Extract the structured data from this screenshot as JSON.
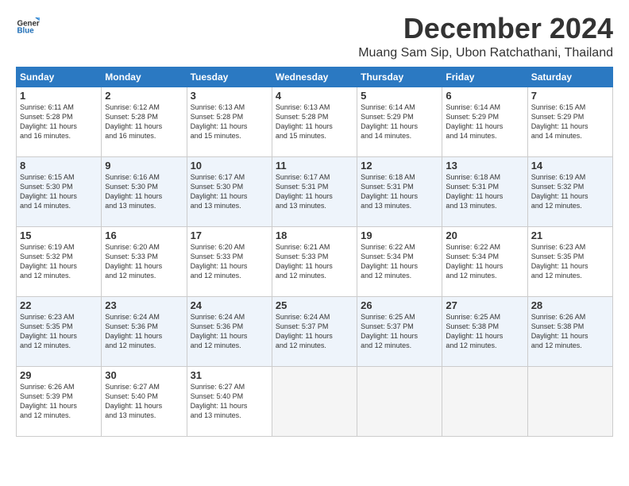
{
  "logo": {
    "general": "General",
    "blue": "Blue"
  },
  "header": {
    "month": "December 2024",
    "location": "Muang Sam Sip, Ubon Ratchathani, Thailand"
  },
  "weekdays": [
    "Sunday",
    "Monday",
    "Tuesday",
    "Wednesday",
    "Thursday",
    "Friday",
    "Saturday"
  ],
  "weeks": [
    [
      {
        "day": 1,
        "info": "Sunrise: 6:11 AM\nSunset: 5:28 PM\nDaylight: 11 hours\nand 16 minutes."
      },
      {
        "day": 2,
        "info": "Sunrise: 6:12 AM\nSunset: 5:28 PM\nDaylight: 11 hours\nand 16 minutes."
      },
      {
        "day": 3,
        "info": "Sunrise: 6:13 AM\nSunset: 5:28 PM\nDaylight: 11 hours\nand 15 minutes."
      },
      {
        "day": 4,
        "info": "Sunrise: 6:13 AM\nSunset: 5:28 PM\nDaylight: 11 hours\nand 15 minutes."
      },
      {
        "day": 5,
        "info": "Sunrise: 6:14 AM\nSunset: 5:29 PM\nDaylight: 11 hours\nand 14 minutes."
      },
      {
        "day": 6,
        "info": "Sunrise: 6:14 AM\nSunset: 5:29 PM\nDaylight: 11 hours\nand 14 minutes."
      },
      {
        "day": 7,
        "info": "Sunrise: 6:15 AM\nSunset: 5:29 PM\nDaylight: 11 hours\nand 14 minutes."
      }
    ],
    [
      {
        "day": 8,
        "info": "Sunrise: 6:15 AM\nSunset: 5:30 PM\nDaylight: 11 hours\nand 14 minutes."
      },
      {
        "day": 9,
        "info": "Sunrise: 6:16 AM\nSunset: 5:30 PM\nDaylight: 11 hours\nand 13 minutes."
      },
      {
        "day": 10,
        "info": "Sunrise: 6:17 AM\nSunset: 5:30 PM\nDaylight: 11 hours\nand 13 minutes."
      },
      {
        "day": 11,
        "info": "Sunrise: 6:17 AM\nSunset: 5:31 PM\nDaylight: 11 hours\nand 13 minutes."
      },
      {
        "day": 12,
        "info": "Sunrise: 6:18 AM\nSunset: 5:31 PM\nDaylight: 11 hours\nand 13 minutes."
      },
      {
        "day": 13,
        "info": "Sunrise: 6:18 AM\nSunset: 5:31 PM\nDaylight: 11 hours\nand 13 minutes."
      },
      {
        "day": 14,
        "info": "Sunrise: 6:19 AM\nSunset: 5:32 PM\nDaylight: 11 hours\nand 12 minutes."
      }
    ],
    [
      {
        "day": 15,
        "info": "Sunrise: 6:19 AM\nSunset: 5:32 PM\nDaylight: 11 hours\nand 12 minutes."
      },
      {
        "day": 16,
        "info": "Sunrise: 6:20 AM\nSunset: 5:33 PM\nDaylight: 11 hours\nand 12 minutes."
      },
      {
        "day": 17,
        "info": "Sunrise: 6:20 AM\nSunset: 5:33 PM\nDaylight: 11 hours\nand 12 minutes."
      },
      {
        "day": 18,
        "info": "Sunrise: 6:21 AM\nSunset: 5:33 PM\nDaylight: 11 hours\nand 12 minutes."
      },
      {
        "day": 19,
        "info": "Sunrise: 6:22 AM\nSunset: 5:34 PM\nDaylight: 11 hours\nand 12 minutes."
      },
      {
        "day": 20,
        "info": "Sunrise: 6:22 AM\nSunset: 5:34 PM\nDaylight: 11 hours\nand 12 minutes."
      },
      {
        "day": 21,
        "info": "Sunrise: 6:23 AM\nSunset: 5:35 PM\nDaylight: 11 hours\nand 12 minutes."
      }
    ],
    [
      {
        "day": 22,
        "info": "Sunrise: 6:23 AM\nSunset: 5:35 PM\nDaylight: 11 hours\nand 12 minutes."
      },
      {
        "day": 23,
        "info": "Sunrise: 6:24 AM\nSunset: 5:36 PM\nDaylight: 11 hours\nand 12 minutes."
      },
      {
        "day": 24,
        "info": "Sunrise: 6:24 AM\nSunset: 5:36 PM\nDaylight: 11 hours\nand 12 minutes."
      },
      {
        "day": 25,
        "info": "Sunrise: 6:24 AM\nSunset: 5:37 PM\nDaylight: 11 hours\nand 12 minutes."
      },
      {
        "day": 26,
        "info": "Sunrise: 6:25 AM\nSunset: 5:37 PM\nDaylight: 11 hours\nand 12 minutes."
      },
      {
        "day": 27,
        "info": "Sunrise: 6:25 AM\nSunset: 5:38 PM\nDaylight: 11 hours\nand 12 minutes."
      },
      {
        "day": 28,
        "info": "Sunrise: 6:26 AM\nSunset: 5:38 PM\nDaylight: 11 hours\nand 12 minutes."
      }
    ],
    [
      {
        "day": 29,
        "info": "Sunrise: 6:26 AM\nSunset: 5:39 PM\nDaylight: 11 hours\nand 12 minutes."
      },
      {
        "day": 30,
        "info": "Sunrise: 6:27 AM\nSunset: 5:40 PM\nDaylight: 11 hours\nand 13 minutes."
      },
      {
        "day": 31,
        "info": "Sunrise: 6:27 AM\nSunset: 5:40 PM\nDaylight: 11 hours\nand 13 minutes."
      },
      null,
      null,
      null,
      null
    ]
  ]
}
